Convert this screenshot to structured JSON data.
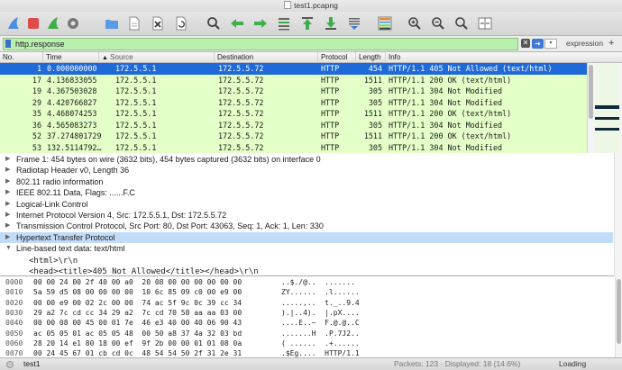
{
  "window": {
    "title": "test1.pcapng"
  },
  "filter": {
    "value": "http.response",
    "expression_label": "expression",
    "add_label": "+"
  },
  "columns": [
    "No.",
    "Time",
    "Source",
    "Destination",
    "Protocol",
    "Length",
    "Info"
  ],
  "packets": [
    {
      "no": "1",
      "time": "0.000000000",
      "src": "172.5.5.1",
      "dst": "172.5.5.72",
      "proto": "HTTP",
      "len": "454",
      "info": "HTTP/1.1 405 Not Allowed  (text/html)"
    },
    {
      "no": "17",
      "time": "4.136833055",
      "src": "172.5.5.1",
      "dst": "172.5.5.72",
      "proto": "HTTP",
      "len": "1511",
      "info": "HTTP/1.1 200 OK  (text/html)"
    },
    {
      "no": "19",
      "time": "4.367503028",
      "src": "172.5.5.1",
      "dst": "172.5.5.72",
      "proto": "HTTP",
      "len": "305",
      "info": "HTTP/1.1 304 Not Modified"
    },
    {
      "no": "29",
      "time": "4.420766827",
      "src": "172.5.5.1",
      "dst": "172.5.5.72",
      "proto": "HTTP",
      "len": "305",
      "info": "HTTP/1.1 304 Not Modified"
    },
    {
      "no": "35",
      "time": "4.468074253",
      "src": "172.5.5.1",
      "dst": "172.5.5.72",
      "proto": "HTTP",
      "len": "1511",
      "info": "HTTP/1.1 200 OK  (text/html)"
    },
    {
      "no": "36",
      "time": "4.565083273",
      "src": "172.5.5.1",
      "dst": "172.5.5.72",
      "proto": "HTTP",
      "len": "305",
      "info": "HTTP/1.1 304 Not Modified"
    },
    {
      "no": "52",
      "time": "37.274801729",
      "src": "172.5.5.1",
      "dst": "172.5.5.72",
      "proto": "HTTP",
      "len": "1511",
      "info": "HTTP/1.1 200 OK  (text/html)"
    },
    {
      "no": "53",
      "time": "132.5114792…",
      "src": "172.5.5.1",
      "dst": "172.5.5.72",
      "proto": "HTTP",
      "len": "305",
      "info": "HTTP/1.1 304 Not Modified"
    }
  ],
  "details": [
    {
      "text": "Frame 1: 454 bytes on wire (3632 bits), 454 bytes captured (3632 bits) on interface 0",
      "expanded": false
    },
    {
      "text": "Radiotap Header v0, Length 36",
      "expanded": false
    },
    {
      "text": "802.11 radio information",
      "expanded": false
    },
    {
      "text": "IEEE 802.11 Data, Flags: ......F.C",
      "expanded": false
    },
    {
      "text": "Logical-Link Control",
      "expanded": false
    },
    {
      "text": "Internet Protocol Version 4, Src: 172.5.5.1, Dst: 172.5.5.72",
      "expanded": false
    },
    {
      "text": "Transmission Control Protocol, Src Port: 80, Dst Port: 43063, Seq: 1, Ack: 1, Len: 330",
      "expanded": false
    },
    {
      "text": "Hypertext Transfer Protocol",
      "expanded": false
    },
    {
      "text": "Line-based text data: text/html",
      "expanded": true
    },
    {
      "text": "<html>\\r\\n",
      "child": true
    },
    {
      "text": "<head><title>405 Not Allowed</title></head>\\r\\n",
      "child": true
    }
  ],
  "bytes": [
    {
      "off": "0000",
      "hex": "00 00 24 00 2f 40 00 a0  20 08 00 00 00 00 00 00",
      "ascii": "..$./@..  ......."
    },
    {
      "off": "0010",
      "hex": "5a 59 d5 08 00 00 00 00  10 6c 85 09 c0 00 e9 00",
      "ascii": "ZY......  .l......"
    },
    {
      "off": "0020",
      "hex": "00 00 e9 00 02 2c 00 00  74 ac 5f 9c 0c 39 cc 34",
      "ascii": ".....,..  t._..9.4"
    },
    {
      "off": "0030",
      "hex": "29 a2 7c cd cc 34 29 a2  7c cd 70 58 aa aa 03 00",
      "ascii": ").|..4).  |.pX...."
    },
    {
      "off": "0040",
      "hex": "00 00 08 00 45 00 01 7e  46 e3 40 00 40 06 90 43",
      "ascii": "....E..~  F.@.@..C"
    },
    {
      "off": "0050",
      "hex": "ac 05 05 01 ac 05 05 48  00 50 a8 37 4a 32 03 bd",
      "ascii": ".......H  .P.7J2.."
    },
    {
      "off": "0060",
      "hex": "28 20 14 e1 80 18 00 ef  9f 2b 00 00 01 01 08 0a",
      "ascii": "( ......  .+......"
    },
    {
      "off": "0070",
      "hex": "00 24 45 67 01 cb cd 0c  48 54 54 50 2f 31 2e 31",
      "ascii": ".$Eg....  HTTP/1.1"
    }
  ],
  "status": {
    "file": "test1",
    "packets": "Packets: 123 · Displayed: 18 (14.6%)",
    "loading": "Loading"
  },
  "colors": {
    "selected": "#1f6ad8",
    "http_row": "#e4ffc7",
    "filter_ok": "#b9f0ae",
    "detail_highlight": "#c2dbf7"
  }
}
